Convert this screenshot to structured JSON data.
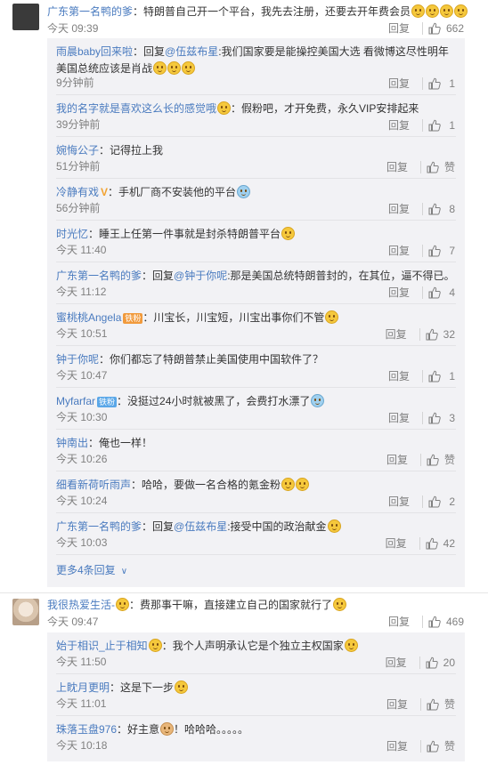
{
  "comments": [
    {
      "user": "广东第一名鸭的爹",
      "text": "：特朗普自己开一个平台，我先去注册，还要去开年费会员",
      "time": "今天 09:39",
      "reply_label": "回复",
      "likes": "662",
      "avatar": "dark-avatar",
      "replies": [
        {
          "user": "雨晨baby回来啦",
          "text": "：回复",
          "mention": "@伍兹布星",
          "text2": ":我们国家要是能操控美国大选 看微博这尽性明年美国总统应该是肖战",
          "time": "9分钟前",
          "reply_label": "回复",
          "likes": "1"
        },
        {
          "user": "我的名字就是喜欢这么长的感觉哦",
          "text": "：假粉吧，才开免费，永久VIP安排起来",
          "time": "39分钟前",
          "reply_label": "回复",
          "likes": "1"
        },
        {
          "user": "婉悔公子",
          "text": "：记得拉上我",
          "time": "51分钟前",
          "reply_label": "回复",
          "likes": "赞"
        },
        {
          "user": "冷静有戏",
          "text": "：手机厂商不安装他的平台",
          "time": "56分钟前",
          "reply_label": "回复",
          "likes": "8"
        },
        {
          "user": "时光忆",
          "text": "：睡王上任第一件事就是封杀特朗普平台",
          "time": "今天 11:40",
          "reply_label": "回复",
          "likes": "7"
        },
        {
          "user": "广东第一名鸭的爹",
          "text": "：回复",
          "mention": "@钟于你呢",
          "text2": ":那是美国总统特朗普封的，在其位，逼不得已。",
          "time": "今天 11:12",
          "reply_label": "回复",
          "likes": "4"
        },
        {
          "user": "蜜桃桃Angela",
          "badge": "铁粉",
          "text": "：川宝长，川宝短，川宝出事你们不管",
          "time": "今天 10:51",
          "reply_label": "回复",
          "likes": "32"
        },
        {
          "user": "钟于你呢",
          "text": "：你们都忘了特朗普禁止美国使用中国软件了？",
          "time": "今天 10:47",
          "reply_label": "回复",
          "likes": "1"
        },
        {
          "user": "Myfarfar",
          "badge": "铁粉",
          "text": "：没挺过24小时就被黑了，会费打水漂了",
          "time": "今天 10:30",
          "reply_label": "回复",
          "likes": "3"
        },
        {
          "user": "钟南出",
          "text": "：俺也一样！",
          "time": "今天 10:26",
          "reply_label": "回复",
          "likes": "赞"
        },
        {
          "user": "细看新荷听雨声",
          "text": "：哈哈，要做一名合格的氪金粉",
          "time": "今天 10:24",
          "reply_label": "回复",
          "likes": "2"
        },
        {
          "user": "广东第一名鸭的爹",
          "text": "：回复",
          "mention": "@伍兹布星",
          "text2": ":接受中国的政治献金",
          "time": "今天 10:03",
          "reply_label": "回复",
          "likes": "42"
        }
      ],
      "more_replies": "更多4条回复"
    },
    {
      "user": "我很热爱生活-",
      "text": "：费那事干嘛，直接建立自己的国家就行了",
      "time": "今天 09:47",
      "reply_label": "回复",
      "likes": "469",
      "avatar": "blonde-avatar",
      "replies": [
        {
          "user": "始于相识_止于相知",
          "text": "：我个人声明承认它是个独立主权国家",
          "time": "今天 11:50",
          "reply_label": "回复",
          "likes": "20"
        },
        {
          "user": "上眈月更明",
          "text": "：这是下一步",
          "time": "今天 11:01",
          "reply_label": "回复",
          "likes": "赞"
        },
        {
          "user": "珠落玉盘976",
          "text": "：好主意",
          "text2": "！哈哈哈。。。。。",
          "time": "今天 10:18",
          "reply_label": "回复",
          "likes": "赞"
        }
      ]
    }
  ],
  "icons": {
    "like": "thumbs-up-icon",
    "emoji": "smiley-emoji-icon",
    "chevron": "chevron-down-icon"
  },
  "colors": {
    "username": "#eb7350",
    "link": "#4a7bbf",
    "meta": "#808080",
    "thread_bg": "#f2f2f5"
  }
}
